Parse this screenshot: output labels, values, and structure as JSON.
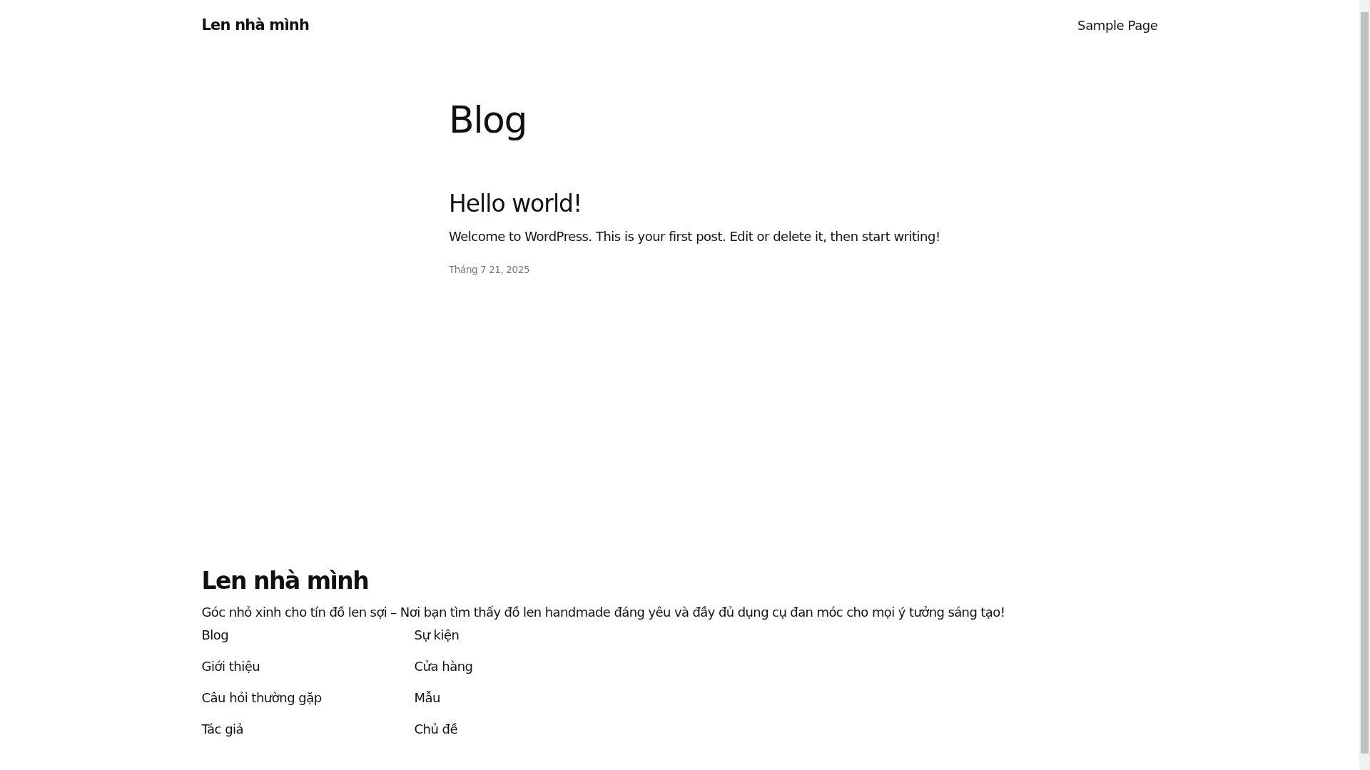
{
  "header": {
    "site_title": "Len nhà mình",
    "nav": [
      "Sample Page"
    ]
  },
  "page_title": "Blog",
  "posts": [
    {
      "title": "Hello world!",
      "excerpt": "Welcome to WordPress. This is your first post. Edit or delete it, then start writing!",
      "date": "Tháng 7 21, 2025"
    }
  ],
  "footer": {
    "site_title": "Len nhà mình",
    "tagline": "Góc nhỏ xinh cho tín đồ len sợi – Nơi bạn tìm thấy đồ len handmade đáng yêu và đầy đủ dụng cụ đan móc cho mọi ý tưởng sáng tạo!",
    "nav_columns": [
      [
        "Blog",
        "Giới thiệu",
        "Câu hỏi thường gặp",
        "Tác giả"
      ],
      [
        "Sự kiện",
        "Cửa hàng",
        "Mẫu",
        "Chủ đề"
      ]
    ]
  }
}
